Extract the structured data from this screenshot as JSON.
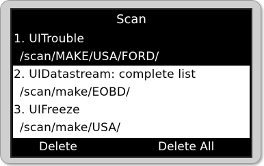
{
  "screen": {
    "title": "Scan"
  },
  "items": [
    {
      "line1": "1. UITrouble",
      "line2": "/scan/MAKE/USA/FORD/",
      "selected": true
    },
    {
      "line1": "2. UIDatastream: complete list",
      "line2": "/scan/make/EOBD/",
      "selected": false
    },
    {
      "line1": "3. UIFreeze",
      "line2": "/scan/make/USA/",
      "selected": false
    }
  ],
  "footer": {
    "left_label": "Delete",
    "right_label": "Delete All"
  },
  "colors": {
    "screen_bg": "#000000",
    "list_bg": "#ffffff",
    "text_dark": "#000000",
    "text_light": "#ffffff",
    "device_bezel": "#cfcfcf"
  }
}
